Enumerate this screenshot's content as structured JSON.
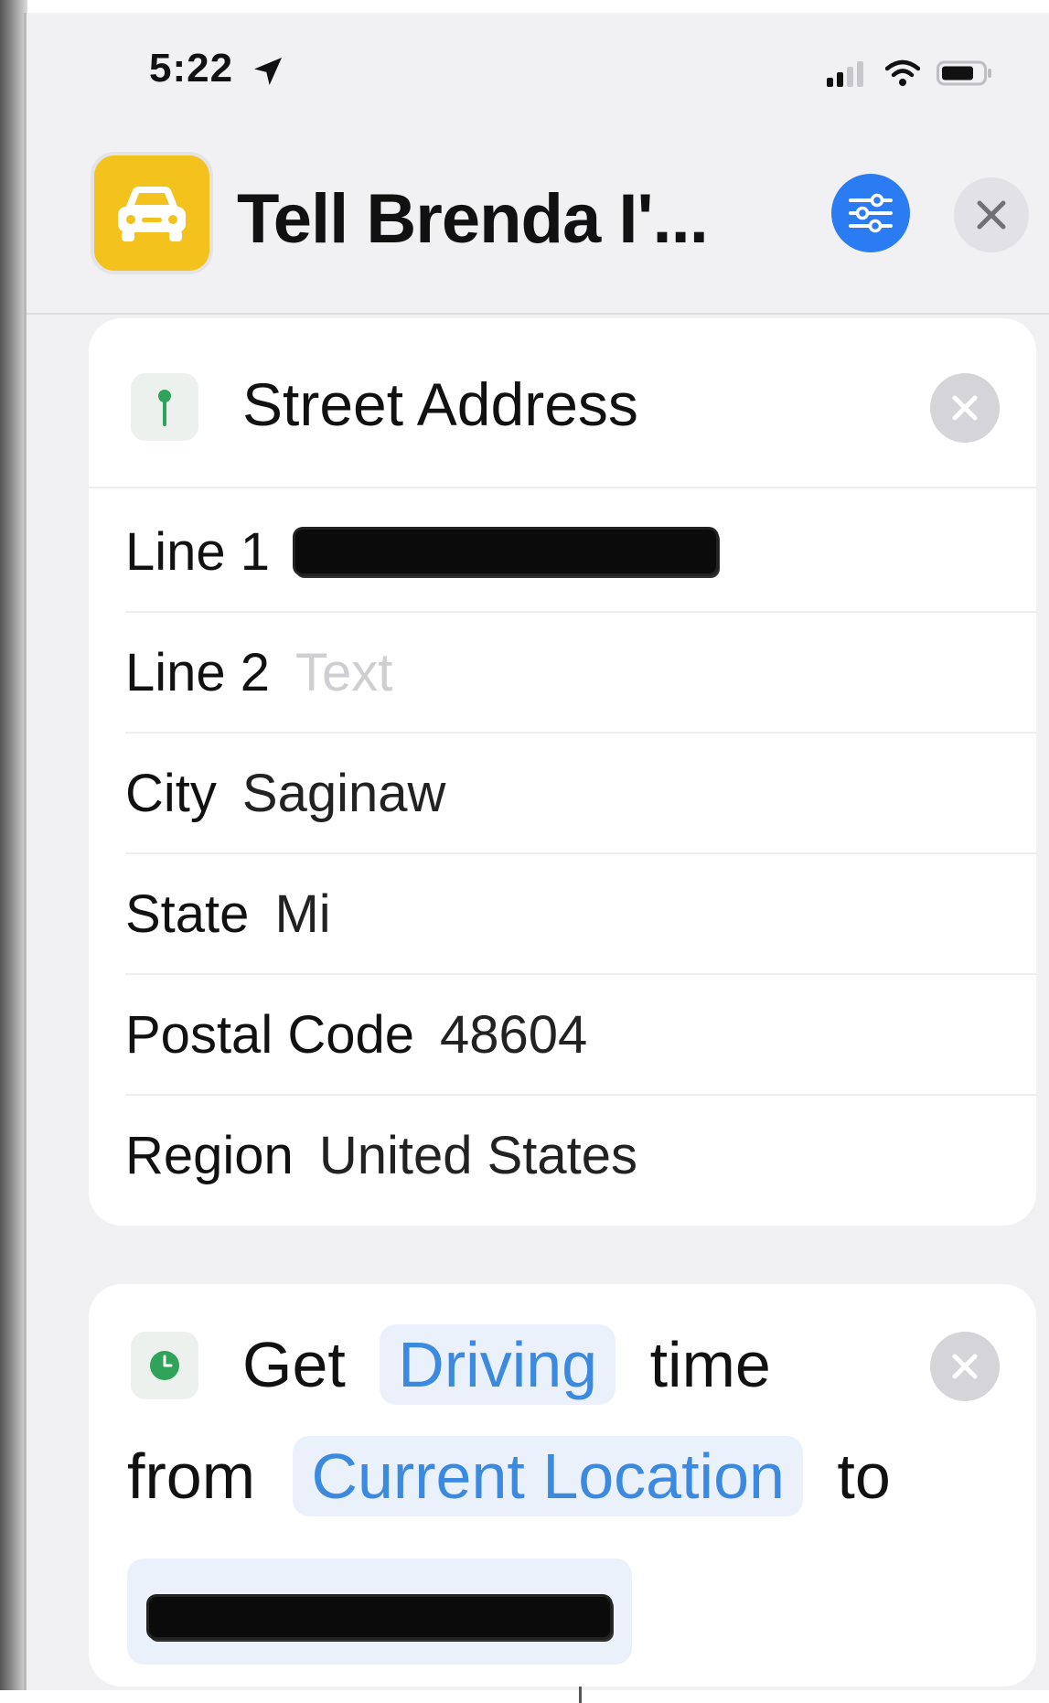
{
  "status_bar": {
    "time": "5:22",
    "icons": [
      "location-arrow-icon",
      "signal-icon",
      "wifi-icon",
      "battery-icon"
    ]
  },
  "header": {
    "title": "Tell Brenda I'...",
    "app_icon": "car-icon",
    "settings_icon": "sliders-icon",
    "close_icon": "close-icon"
  },
  "street_address": {
    "title": "Street Address",
    "icon": "map-pin-icon",
    "fields": [
      {
        "label": "Line 1",
        "value": "",
        "redacted": true
      },
      {
        "label": "Line 2",
        "value": "",
        "placeholder": "Text"
      },
      {
        "label": "City",
        "value": "Saginaw"
      },
      {
        "label": "State",
        "value": "Mi"
      },
      {
        "label": "Postal Code",
        "value": "48604"
      },
      {
        "label": "Region",
        "value": "United States"
      }
    ]
  },
  "travel_time": {
    "icon": "clock-icon",
    "word_get": "Get",
    "mode": "Driving",
    "word_time": "time",
    "word_from": "from",
    "origin": "Current Location",
    "word_to": "to",
    "destination_redacted": true
  },
  "colors": {
    "accent_blue": "#2b7cf2",
    "token_text": "#3b8ae0",
    "token_bg": "#eaf1fb",
    "app_icon_yellow": "#f3c21d",
    "background": "#f1f1f4"
  }
}
